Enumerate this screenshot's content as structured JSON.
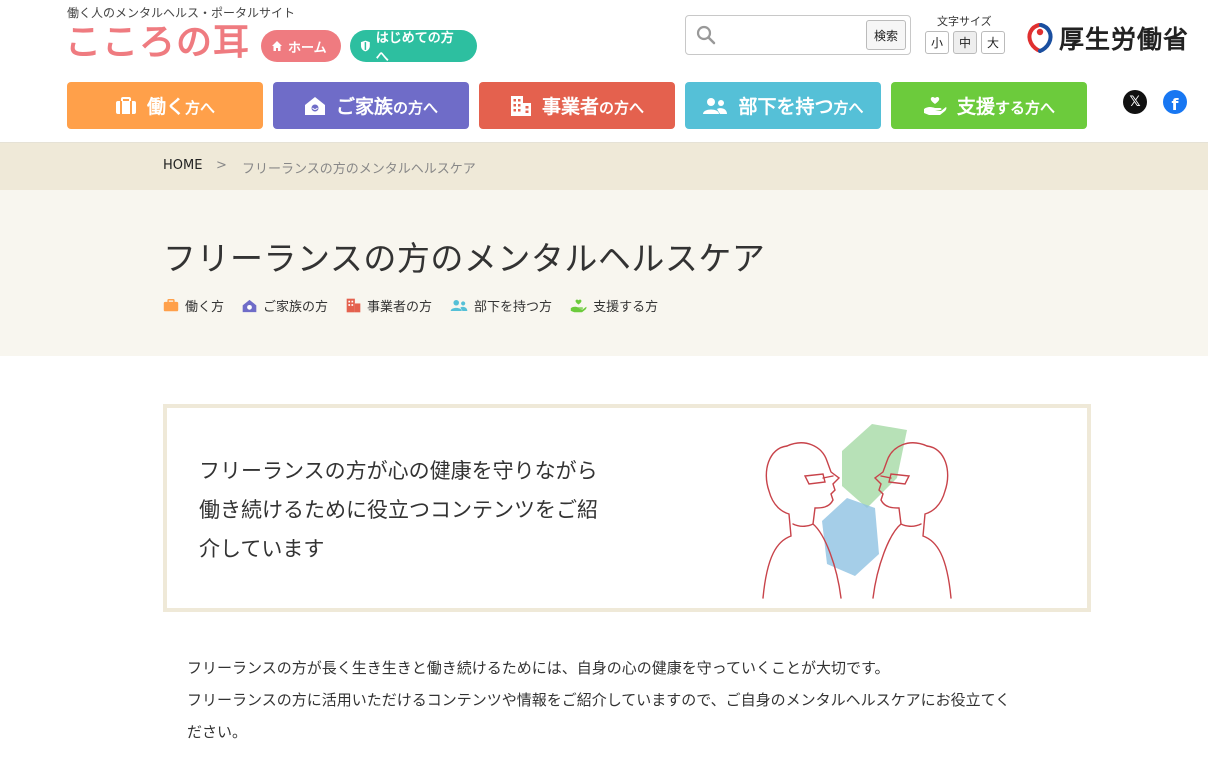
{
  "header": {
    "tagline": "働く人のメンタルヘルス・ポータルサイト",
    "logo": "こころの耳",
    "home_pill": "ホーム",
    "first_pill": "はじめての方へ",
    "search": {
      "placeholder": "",
      "button": "検索"
    },
    "font_size": {
      "label": "文字サイズ",
      "small": "小",
      "medium": "中",
      "large": "大",
      "active": "中"
    },
    "ministry": "厚生労働省"
  },
  "nav": [
    {
      "main": "働く",
      "sub": "方へ",
      "color": "#ffa04a",
      "icon": "briefcase-icon"
    },
    {
      "main": "ご家族",
      "sub": "の方へ",
      "color": "#6f6cc8",
      "icon": "house-icon"
    },
    {
      "main": "事業者",
      "sub": "の方へ",
      "color": "#e4614e",
      "icon": "building-icon"
    },
    {
      "main": "部下を持つ",
      "sub": "方へ",
      "color": "#55c0d7",
      "icon": "people-icon"
    },
    {
      "main": "支援",
      "sub": "する方へ",
      "color": "#6ccb3c",
      "icon": "helping-hand-icon"
    }
  ],
  "social": {
    "x": "𝕏",
    "facebook": "f"
  },
  "breadcrumb": {
    "home": "HOME",
    "separator": ">",
    "current": "フリーランスの方のメンタルヘルスケア"
  },
  "page": {
    "title": "フリーランスの方のメンタルヘルスケア",
    "tags": [
      {
        "label": "働く方",
        "color": "#ffa04a"
      },
      {
        "label": "ご家族の方",
        "color": "#6f6cc8"
      },
      {
        "label": "事業者の方",
        "color": "#e4614e"
      },
      {
        "label": "部下を持つ方",
        "color": "#55c0d7"
      },
      {
        "label": "支援する方",
        "color": "#6ccb3c"
      }
    ]
  },
  "hero": {
    "lines": [
      "フリーランスの方が心の健康を守りながら",
      "働き続けるために役立つコンテンツをご紹",
      "介しています"
    ]
  },
  "body": {
    "lines": [
      "フリーランスの方が長く生き生きと働き続けるためには、自身の心の健康を守っていくことが大切です。",
      "フリーランスの方に活用いただけるコンテンツや情報をご紹介していますので、ご自身のメンタルヘルスケアにお役立てく",
      "ださい。"
    ]
  }
}
